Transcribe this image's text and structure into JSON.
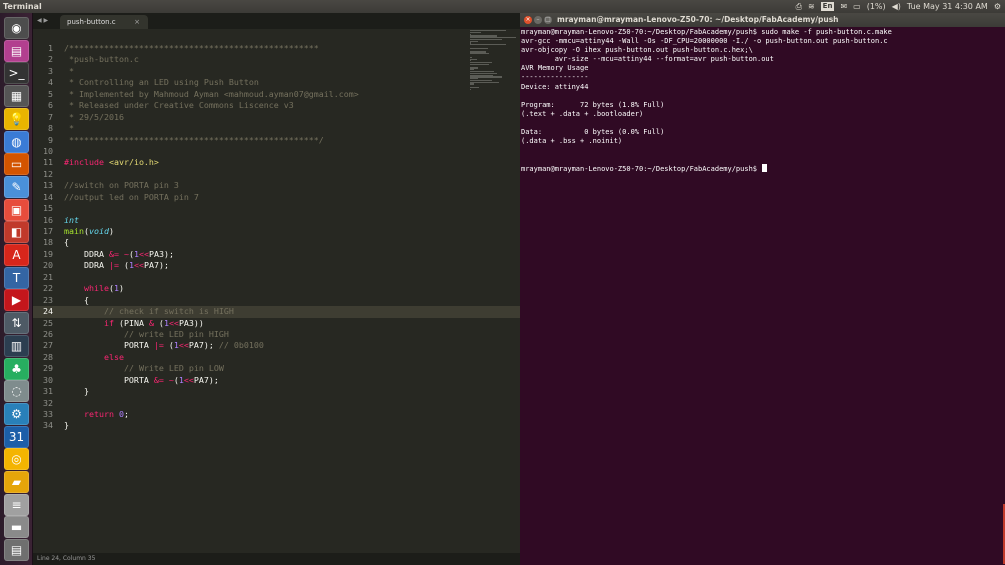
{
  "top_panel": {
    "app_title": "Terminal",
    "keyboard_layout": "En",
    "battery": "(1%)",
    "clock": "Tue May 31  4:30 AM"
  },
  "launcher": {
    "items": [
      {
        "name": "dash-icon",
        "glyph": "◉",
        "color": "#4d4d4d"
      },
      {
        "name": "software-center-icon",
        "glyph": "▤",
        "color": "#b23f8f"
      },
      {
        "name": "terminal-icon",
        "glyph": ">_",
        "color": "#333333"
      },
      {
        "name": "workspace-switcher-icon",
        "glyph": "▦",
        "color": "#555555"
      },
      {
        "name": "idea-bulb-icon",
        "glyph": "💡",
        "color": "#e8b400"
      },
      {
        "name": "browser-icon",
        "glyph": "◍",
        "color": "#3a7bd5"
      },
      {
        "name": "files-icon",
        "glyph": "▭",
        "color": "#d35400"
      },
      {
        "name": "text-editor-icon",
        "glyph": "✎",
        "color": "#4a90d9"
      },
      {
        "name": "presentation-icon",
        "glyph": "▣",
        "color": "#e74c3c"
      },
      {
        "name": "image-viewer-icon",
        "glyph": "◧",
        "color": "#c0392b"
      },
      {
        "name": "pdf-icon",
        "glyph": "A",
        "color": "#d7261b"
      },
      {
        "name": "fonts-icon",
        "glyph": "T",
        "color": "#3465a4"
      },
      {
        "name": "media-icon",
        "glyph": "▶",
        "color": "#c4161c"
      },
      {
        "name": "network-icon",
        "glyph": "⇅",
        "color": "#4e5a65"
      },
      {
        "name": "chart-icon",
        "glyph": "▥",
        "color": "#2c3e50"
      },
      {
        "name": "game-icon",
        "glyph": "♣",
        "color": "#27ae60"
      },
      {
        "name": "disk-icon",
        "glyph": "◌",
        "color": "#7f8c8d"
      },
      {
        "name": "settings-icon",
        "glyph": "⚙",
        "color": "#2980b9"
      },
      {
        "name": "calendar-icon",
        "glyph": "31",
        "color": "#1c5ea8"
      },
      {
        "name": "chrome-icon",
        "glyph": "◎",
        "color": "#f4b400"
      },
      {
        "name": "folder-icon",
        "glyph": "▰",
        "color": "#e5a50a"
      },
      {
        "name": "stack-icon",
        "glyph": "≡",
        "color": "#a0a0a0"
      },
      {
        "name": "drive-icon",
        "glyph": "▬",
        "color": "#8a8a8a"
      },
      {
        "name": "trash-icon",
        "glyph": "▤",
        "color": "#6f6f6f"
      }
    ]
  },
  "editor": {
    "tab_label": "push-button.c",
    "tab_close": "×",
    "status": "Line 24, Column 35",
    "lines": [
      {
        "n": "1",
        "html": "<span class=\"cm\">/**************************************************</span>"
      },
      {
        "n": "2",
        "html": "<span class=\"cm\"> *push-button.c</span>"
      },
      {
        "n": "3",
        "html": "<span class=\"cm\"> *</span>"
      },
      {
        "n": "4",
        "html": "<span class=\"cm\"> * Controlling an LED using Push Button</span>"
      },
      {
        "n": "5",
        "html": "<span class=\"cm\"> * Implemented by Mahmoud Ayman &lt;mahmoud.ayman07@gmail.com&gt;</span>"
      },
      {
        "n": "6",
        "html": "<span class=\"cm\"> * Released under Creative Commons Liscence v3</span>"
      },
      {
        "n": "7",
        "html": "<span class=\"cm\"> * 29/5/2016</span>"
      },
      {
        "n": "8",
        "html": "<span class=\"cm\"> *</span>"
      },
      {
        "n": "9",
        "html": "<span class=\"cm\"> **************************************************/</span>"
      },
      {
        "n": "10",
        "html": ""
      },
      {
        "n": "11",
        "html": "<span class=\"kw\">#include</span> <span class=\"st\">&lt;avr/io.h&gt;</span>"
      },
      {
        "n": "12",
        "html": ""
      },
      {
        "n": "13",
        "html": "<span class=\"cm\">//switch on PORTA pin 3</span>"
      },
      {
        "n": "14",
        "html": "<span class=\"cm\">//output led on PORTA pin 7</span>"
      },
      {
        "n": "15",
        "html": ""
      },
      {
        "n": "16",
        "html": "<span class=\"ty\">int</span>"
      },
      {
        "n": "17",
        "html": "<span class=\"fn\">main</span>(<span class=\"ty\">void</span>)"
      },
      {
        "n": "18",
        "html": "{"
      },
      {
        "n": "19",
        "html": "    DDRA <span class=\"kw\">&amp;=</span> <span class=\"kw\">~</span>(<span class=\"nm\">1</span><span class=\"kw\">&lt;&lt;</span>PA3);"
      },
      {
        "n": "20",
        "html": "    DDRA <span class=\"kw\">|=</span> (<span class=\"nm\">1</span><span class=\"kw\">&lt;&lt;</span>PA7);"
      },
      {
        "n": "21",
        "html": ""
      },
      {
        "n": "22",
        "html": "    <span class=\"kw\">while</span>(<span class=\"nm\">1</span>)"
      },
      {
        "n": "23",
        "html": "    {"
      },
      {
        "n": "24",
        "html": "        <span class=\"cm\">// check if switch is HIGH</span>",
        "current": true
      },
      {
        "n": "25",
        "html": "        <span class=\"kw\">if</span> (PINA <span class=\"kw\">&amp;</span> (<span class=\"nm\">1</span><span class=\"kw\">&lt;&lt;</span>PA3))"
      },
      {
        "n": "26",
        "html": "            <span class=\"cm\">// write LED pin HIGH</span>"
      },
      {
        "n": "27",
        "html": "            PORTA <span class=\"kw\">|=</span> (<span class=\"nm\">1</span><span class=\"kw\">&lt;&lt;</span>PA7); <span class=\"cm\">// 0b0100</span>"
      },
      {
        "n": "28",
        "html": "        <span class=\"kw\">else</span>"
      },
      {
        "n": "29",
        "html": "            <span class=\"cm\">// Write LED pin LOW</span>"
      },
      {
        "n": "30",
        "html": "            PORTA <span class=\"kw\">&amp;=</span> <span class=\"kw\">~</span>(<span class=\"nm\">1</span><span class=\"kw\">&lt;&lt;</span>PA7);"
      },
      {
        "n": "31",
        "html": "    }"
      },
      {
        "n": "32",
        "html": ""
      },
      {
        "n": "33",
        "html": "    <span class=\"kw\">return</span> <span class=\"nm\">0</span>;"
      },
      {
        "n": "34",
        "html": "}"
      }
    ]
  },
  "terminal": {
    "title": "mrayman@mrayman-Lenovo-Z50-70: ~/Desktop/FabAcademy/push",
    "lines": [
      "mrayman@mrayman-Lenovo-Z50-70:~/Desktop/FabAcademy/push$ sudo make -f push-button.c.make",
      "avr-gcc -mmcu=attiny44 -Wall -Os -DF_CPU=20000000 -I./ -o push-button.out push-button.c",
      "avr-objcopy -O ihex push-button.out push-button.c.hex;\\",
      "        avr-size --mcu=attiny44 --format=avr push-button.out",
      "AVR Memory Usage",
      "----------------",
      "Device: attiny44",
      "",
      "Program:      72 bytes (1.8% Full)",
      "(.text + .data + .bootloader)",
      "",
      "Data:          0 bytes (0.0% Full)",
      "(.data + .bss + .noinit)",
      "",
      "",
      "mrayman@mrayman-Lenovo-Z50-70:~/Desktop/FabAcademy/push$ "
    ]
  }
}
